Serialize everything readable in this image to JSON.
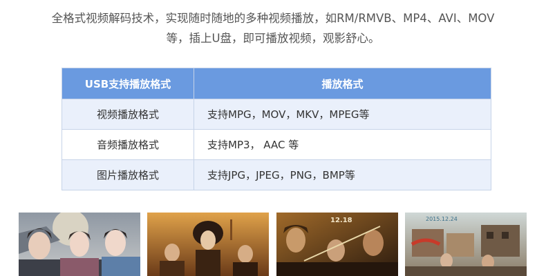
{
  "intro": {
    "line1": "全格式视频解码技术，实现随时随地的多种视频播放，如RM/RMVB、MP4、AVI、MOV",
    "line2": "等，插上U盘，即可播放视频，观影舒心。"
  },
  "table": {
    "headers": [
      "USB支持播放格式",
      "播放格式"
    ],
    "rows": [
      {
        "label": "视频播放格式",
        "value": "支持MPG，MOV，MKV，MPEG等"
      },
      {
        "label": "音频播放格式",
        "value": "支持MP3， AAC 等"
      },
      {
        "label": "图片播放格式",
        "value": "支持JPG，JPEG，PNG，BMP等"
      }
    ],
    "colors": {
      "header_bg": "#6a9ae0",
      "alt_row_bg": "#eaf0fb",
      "border": "#c6d3e8"
    }
  },
  "posters": [
    {
      "name": "poster-1"
    },
    {
      "name": "poster-2"
    },
    {
      "name": "poster-3",
      "caption_date": "12.18"
    },
    {
      "name": "poster-4",
      "caption_date": "2015.12.24"
    }
  ]
}
